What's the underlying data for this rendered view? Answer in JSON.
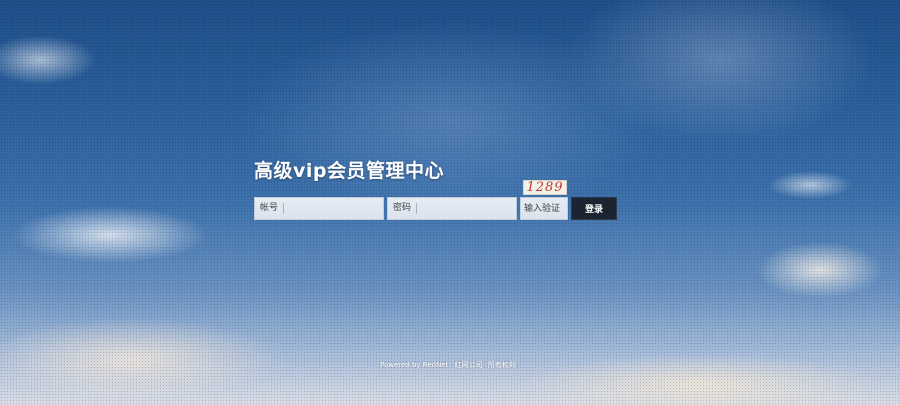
{
  "login": {
    "title": "高级vip会员管理中心",
    "account_label": "帐号",
    "account_value": "",
    "password_label": "密码",
    "password_value": "",
    "captcha_code": "1289",
    "captcha_placeholder": "输入验证",
    "login_button": "登录"
  },
  "footer": {
    "powered_by": "Powered by RedNet",
    "link1": "红网公司",
    "link2": "所有权利"
  }
}
